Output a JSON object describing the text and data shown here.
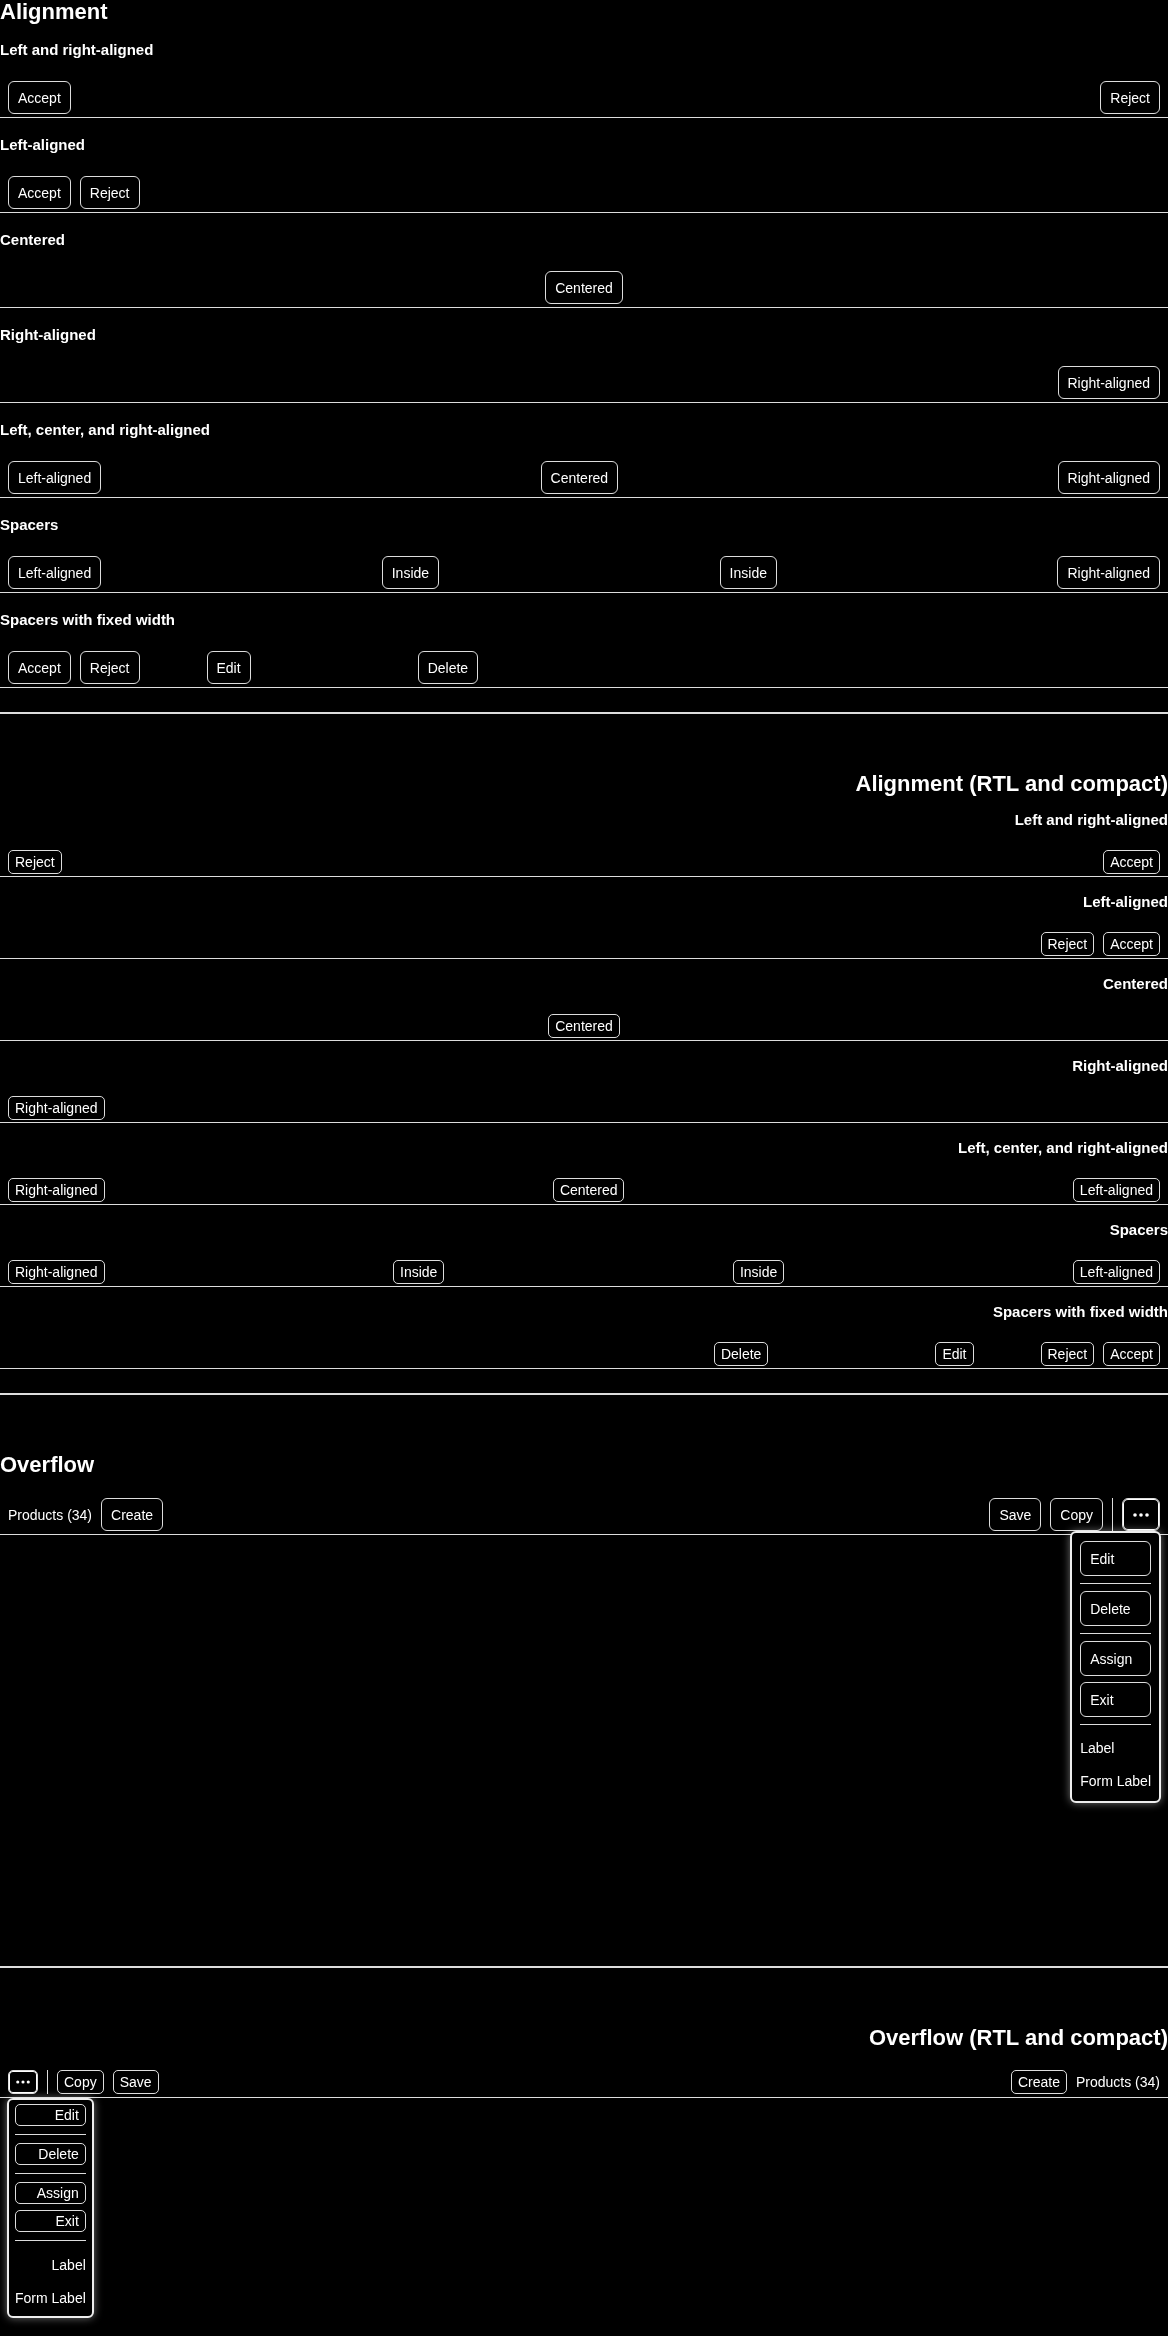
{
  "sections": [
    {
      "kind": "alignment",
      "title": "Alignment",
      "rtl": false,
      "compact": false,
      "rows": [
        {
          "title": "Left and right-aligned",
          "items": [
            {
              "kind": "button",
              "label": "Accept"
            },
            {
              "kind": "flex-spacer"
            },
            {
              "kind": "button",
              "label": "Reject"
            }
          ]
        },
        {
          "title": "Left-aligned",
          "items": [
            {
              "kind": "button",
              "label": "Accept"
            },
            {
              "kind": "button",
              "label": "Reject"
            },
            {
              "kind": "flex-spacer"
            }
          ]
        },
        {
          "title": "Centered",
          "items": [
            {
              "kind": "flex-spacer"
            },
            {
              "kind": "button",
              "label": "Centered"
            },
            {
              "kind": "flex-spacer"
            }
          ]
        },
        {
          "title": "Right-aligned",
          "items": [
            {
              "kind": "flex-spacer"
            },
            {
              "kind": "button",
              "label": "Right-aligned"
            }
          ]
        },
        {
          "title": "Left, center, and right-aligned",
          "items": [
            {
              "kind": "button",
              "label": "Left-aligned"
            },
            {
              "kind": "flex-spacer"
            },
            {
              "kind": "button",
              "label": "Centered"
            },
            {
              "kind": "flex-spacer"
            },
            {
              "kind": "button",
              "label": "Right-aligned"
            }
          ]
        },
        {
          "title": "Spacers",
          "items": [
            {
              "kind": "button",
              "label": "Left-aligned"
            },
            {
              "kind": "flex-spacer"
            },
            {
              "kind": "button",
              "label": "Inside"
            },
            {
              "kind": "flex-spacer"
            },
            {
              "kind": "button",
              "label": "Inside"
            },
            {
              "kind": "flex-spacer"
            },
            {
              "kind": "button",
              "label": "Right-aligned"
            }
          ]
        },
        {
          "title": "Spacers with fixed width",
          "items": [
            {
              "kind": "button",
              "label": "Accept"
            },
            {
              "kind": "button",
              "label": "Reject"
            },
            {
              "kind": "spacer"
            },
            {
              "kind": "button",
              "label": "Edit"
            },
            {
              "kind": "wide-spacer"
            },
            {
              "kind": "button",
              "label": "Delete"
            },
            {
              "kind": "flex-spacer"
            }
          ]
        }
      ]
    },
    {
      "kind": "alignment",
      "title": "Alignment (RTL and compact)",
      "rtl": true,
      "compact": true,
      "rows": [
        {
          "title": "Left and right-aligned",
          "items": [
            {
              "kind": "button",
              "label": "Reject"
            },
            {
              "kind": "flex-spacer"
            },
            {
              "kind": "button",
              "label": "Accept"
            }
          ]
        },
        {
          "title": "Left-aligned",
          "items": [
            {
              "kind": "flex-spacer"
            },
            {
              "kind": "button",
              "label": "Reject"
            },
            {
              "kind": "button",
              "label": "Accept"
            }
          ]
        },
        {
          "title": "Centered",
          "items": [
            {
              "kind": "flex-spacer"
            },
            {
              "kind": "button",
              "label": "Centered"
            },
            {
              "kind": "flex-spacer"
            }
          ]
        },
        {
          "title": "Right-aligned",
          "items": [
            {
              "kind": "button",
              "label": "Right-aligned"
            },
            {
              "kind": "flex-spacer"
            }
          ]
        },
        {
          "title": "Left, center, and right-aligned",
          "items": [
            {
              "kind": "button",
              "label": "Right-aligned"
            },
            {
              "kind": "flex-spacer"
            },
            {
              "kind": "button",
              "label": "Centered"
            },
            {
              "kind": "flex-spacer"
            },
            {
              "kind": "button",
              "label": "Left-aligned"
            }
          ]
        },
        {
          "title": "Spacers",
          "items": [
            {
              "kind": "button",
              "label": "Right-aligned"
            },
            {
              "kind": "flex-spacer"
            },
            {
              "kind": "button",
              "label": "Inside"
            },
            {
              "kind": "flex-spacer"
            },
            {
              "kind": "button",
              "label": "Inside"
            },
            {
              "kind": "flex-spacer"
            },
            {
              "kind": "button",
              "label": "Left-aligned"
            }
          ]
        },
        {
          "title": "Spacers with fixed width",
          "items": [
            {
              "kind": "flex-spacer"
            },
            {
              "kind": "button",
              "label": "Delete"
            },
            {
              "kind": "wide-spacer"
            },
            {
              "kind": "button",
              "label": "Edit"
            },
            {
              "kind": "spacer"
            },
            {
              "kind": "button",
              "label": "Reject"
            },
            {
              "kind": "button",
              "label": "Accept"
            }
          ]
        }
      ]
    },
    {
      "kind": "overflow",
      "title": "Overflow",
      "rtl": false,
      "compact": false,
      "toolbar": [
        {
          "kind": "label",
          "label": "Products (34)"
        },
        {
          "kind": "button",
          "label": "Create"
        },
        {
          "kind": "flex-spacer"
        },
        {
          "kind": "button",
          "label": "Save"
        },
        {
          "kind": "button",
          "label": "Copy"
        },
        {
          "kind": "separator"
        },
        {
          "kind": "overflow-button",
          "expanded": true
        }
      ],
      "menu": [
        {
          "kind": "button",
          "label": "Edit"
        },
        {
          "kind": "separator"
        },
        {
          "kind": "button",
          "label": "Delete"
        },
        {
          "kind": "separator"
        },
        {
          "kind": "button",
          "label": "Assign"
        },
        {
          "kind": "button",
          "label": "Exit"
        },
        {
          "kind": "separator"
        },
        {
          "kind": "label",
          "label": "Label"
        },
        {
          "kind": "label",
          "label": "Form Label"
        }
      ]
    },
    {
      "kind": "overflow",
      "title": "Overflow (RTL and compact)",
      "rtl": true,
      "compact": true,
      "toolbar": [
        {
          "kind": "overflow-button",
          "expanded": true
        },
        {
          "kind": "separator"
        },
        {
          "kind": "button",
          "label": "Copy"
        },
        {
          "kind": "button",
          "label": "Save"
        },
        {
          "kind": "flex-spacer"
        },
        {
          "kind": "button",
          "label": "Create"
        },
        {
          "kind": "label",
          "label": "Products (34)"
        }
      ],
      "menu": [
        {
          "kind": "button",
          "label": "Edit"
        },
        {
          "kind": "separator"
        },
        {
          "kind": "button",
          "label": "Delete"
        },
        {
          "kind": "separator"
        },
        {
          "kind": "button",
          "label": "Assign"
        },
        {
          "kind": "button",
          "label": "Exit"
        },
        {
          "kind": "separator"
        },
        {
          "kind": "label",
          "label": "Label"
        },
        {
          "kind": "label",
          "label": "Form Label"
        }
      ]
    }
  ]
}
